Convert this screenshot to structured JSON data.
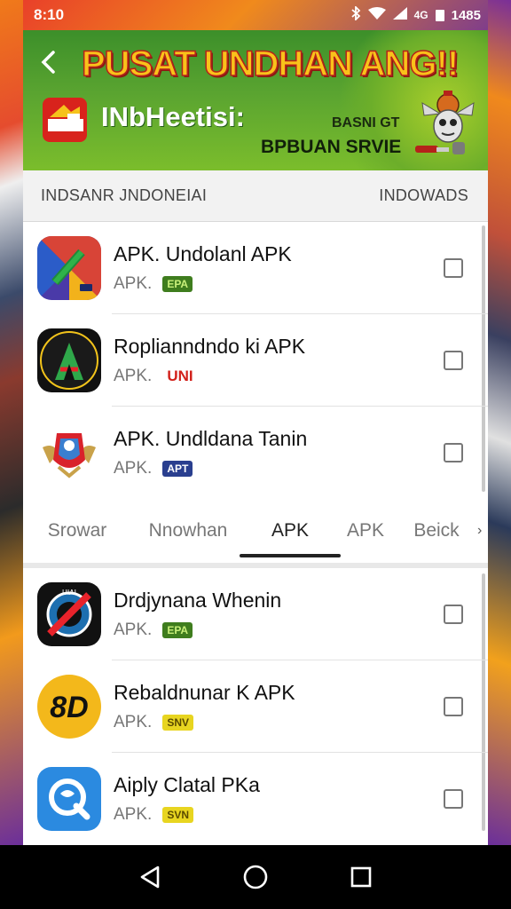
{
  "status_bar": {
    "time": "8:10",
    "battery_text": "1485",
    "signal_text": "4G",
    "icons": [
      "bluetooth-icon",
      "wifi-icon",
      "signal-icon",
      "battery-icon"
    ]
  },
  "banner": {
    "title": "PUSAT UNDHAN ANG!!",
    "brand": "INbHeetisi:",
    "small_text": "BASNI GT",
    "service_text": "BPBUAN SRVIE"
  },
  "list_header": {
    "left": "INDSANR JNDONEIAI",
    "right": "INDOWADS"
  },
  "apps_top": [
    {
      "name": "APK. Undolanl APK",
      "label": "APK.",
      "badge": "EPA",
      "badge_bg": "#3f7d1e",
      "badge_fg": "#c9f07a",
      "icon": "pencil-square-icon"
    },
    {
      "name": "Roplianndndo ki APK",
      "label": "APK.",
      "badge": "UNI",
      "badge_bg": "#ffffff",
      "badge_fg": "#d2201a",
      "icon": "letter-a-icon"
    },
    {
      "name": "APK. Undldana Tanin",
      "label": "APK.",
      "badge": "APT",
      "badge_bg": "#2a3f8f",
      "badge_fg": "#ffffff",
      "icon": "garuda-emblem-icon"
    }
  ],
  "tabs": [
    {
      "label": "Srowar",
      "active": false
    },
    {
      "label": "Nnowhan",
      "active": false
    },
    {
      "label": "APK",
      "active": true
    },
    {
      "label": "APK",
      "active": false
    },
    {
      "label": "Beick",
      "active": false
    }
  ],
  "apps_bottom": [
    {
      "name": "Drdjynana Whenin",
      "label": "APK.",
      "badge": "EPA",
      "badge_bg": "#3f7d1e",
      "badge_fg": "#c9f07a",
      "icon": "no-symbol-icon"
    },
    {
      "name": "Rebaldnunar K APK",
      "label": "APK.",
      "badge": "SNV",
      "badge_bg": "#e8d520",
      "badge_fg": "#5a4a00",
      "icon": "letter-d-icon"
    },
    {
      "name": "Aiply Clatal PKa",
      "label": "APK.",
      "badge": "SVN",
      "badge_bg": "#e8d520",
      "badge_fg": "#5a4a00",
      "icon": "search-circle-icon"
    }
  ],
  "nav": [
    "back-nav-icon",
    "home-nav-icon",
    "recents-nav-icon"
  ]
}
